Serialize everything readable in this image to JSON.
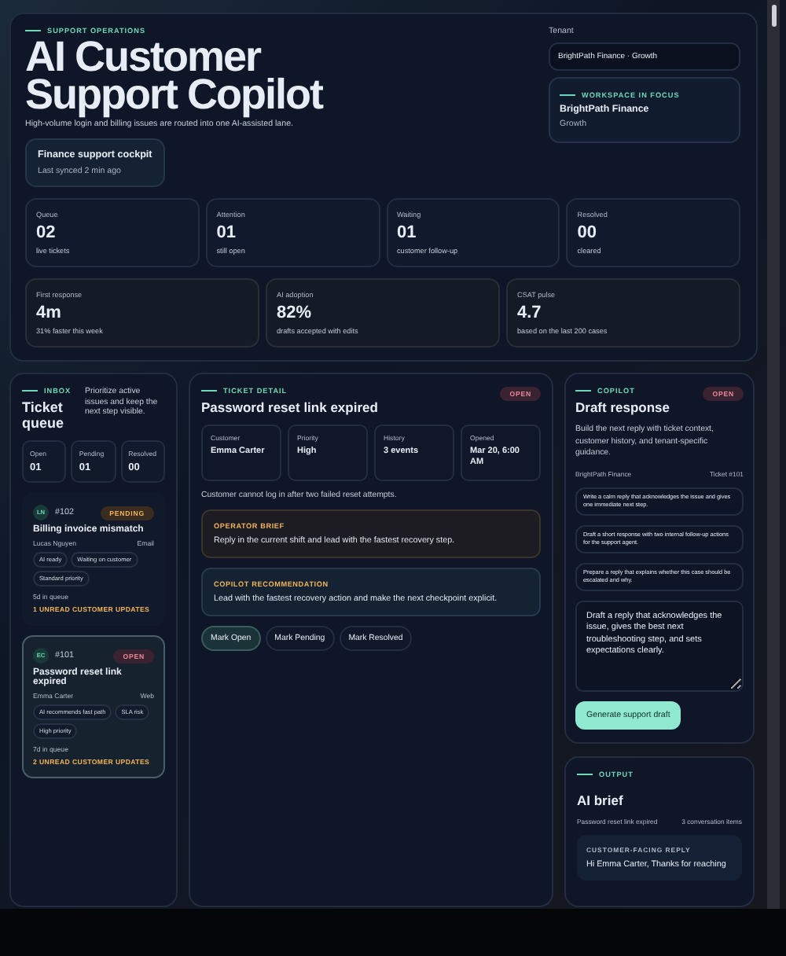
{
  "hero": {
    "kicker": "SUPPORT OPERATIONS",
    "title_lines": [
      "AI Customer",
      "Support Copilot"
    ],
    "subtitle": "High-volume login and billing issues are routed into one AI-assisted lane.",
    "cockpit": {
      "title": "Finance support cockpit",
      "subtitle": "Last synced 2 min ago"
    },
    "tenant": {
      "label": "Tenant",
      "value": "BrightPath Finance · Growth"
    },
    "workspace": {
      "kicker": "WORKSPACE IN FOCUS",
      "name": "BrightPath Finance",
      "plan": "Growth"
    }
  },
  "stats": [
    {
      "label": "Queue",
      "value": "02",
      "note": "live tickets"
    },
    {
      "label": "Attention",
      "value": "01",
      "note": "still open"
    },
    {
      "label": "Waiting",
      "value": "01",
      "note": "customer follow-up"
    },
    {
      "label": "Resolved",
      "value": "00",
      "note": "cleared"
    }
  ],
  "metrics": [
    {
      "label": "First response",
      "value": "4m",
      "note": "31% faster this week"
    },
    {
      "label": "AI adoption",
      "value": "82%",
      "note": "drafts accepted with edits"
    },
    {
      "label": "CSAT pulse",
      "value": "4.7",
      "note": "based on the last 200 cases"
    }
  ],
  "inbox": {
    "kicker": "INBOX",
    "title": "Ticket queue",
    "description": "Prioritize active issues and keep the next step visible.",
    "counts": [
      {
        "label": "Open",
        "value": "01"
      },
      {
        "label": "Pending",
        "value": "01"
      },
      {
        "label": "Resolved",
        "value": "00"
      }
    ],
    "tickets": [
      {
        "initials": "LN",
        "id": "#102",
        "status": "PENDING",
        "kind": "pending",
        "title": "Billing invoice mismatch",
        "customer": "Lucas Nguyen",
        "channel": "Email",
        "tags": [
          "AI ready",
          "Waiting on customer",
          "Standard priority"
        ],
        "queue_time": "5d in queue",
        "updates": "1 UNREAD CUSTOMER UPDATES",
        "selected": false
      },
      {
        "initials": "EC",
        "id": "#101",
        "status": "OPEN",
        "kind": "open",
        "title": "Password reset link expired",
        "customer": "Emma Carter",
        "channel": "Web",
        "tags": [
          "AI recommends fast path",
          "SLA risk",
          "High priority"
        ],
        "queue_time": "7d in queue",
        "updates": "2 UNREAD CUSTOMER UPDATES",
        "selected": true
      }
    ]
  },
  "detail": {
    "kicker": "TICKET DETAIL",
    "status": "OPEN",
    "kind": "open",
    "title": "Password reset link expired",
    "fields": [
      {
        "label": "Customer",
        "value": "Emma Carter"
      },
      {
        "label": "Priority",
        "value": "High"
      },
      {
        "label": "History",
        "value": "3 events"
      },
      {
        "label": "Opened",
        "value": "Mar 20, 6:00 AM"
      }
    ],
    "summary": "Customer cannot log in after two failed reset attempts.",
    "notes": [
      {
        "kind": "brief",
        "heading": "OPERATOR BRIEF",
        "text": "Reply in the current shift and lead with the fastest recovery step."
      },
      {
        "kind": "recommendation",
        "heading": "COPILOT RECOMMENDATION",
        "text": "Lead with the fastest recovery action and make the next checkpoint explicit."
      }
    ],
    "actions": [
      {
        "label": "Mark Open",
        "selected": true
      },
      {
        "label": "Mark Pending",
        "selected": false
      },
      {
        "label": "Mark Resolved",
        "selected": false
      }
    ]
  },
  "copilot": {
    "kicker": "COPILOT",
    "status": "OPEN",
    "kind": "open",
    "title": "Draft response",
    "description": "Build the next reply with ticket context, customer history, and tenant-specific guidance.",
    "tenant": "BrightPath Finance",
    "ticket": "Ticket #101",
    "prompts": [
      "Write a calm reply that acknowledges the issue and gives one immediate next step.",
      "Draft a short response with two internal follow-up actions for the support agent.",
      "Prepare a reply that explains whether this case should be escalated and why."
    ],
    "draft": "Draft a reply that acknowledges the issue, gives the best next troubleshooting step, and sets expectations clearly.",
    "button": "Generate support draft"
  },
  "output": {
    "kicker": "OUTPUT",
    "title": "AI brief",
    "subject": "Password reset link expired",
    "count": "3 conversation items",
    "reply": {
      "heading": "CUSTOMER-FACING REPLY",
      "text": "Hi Emma Carter, Thanks for reaching"
    }
  }
}
